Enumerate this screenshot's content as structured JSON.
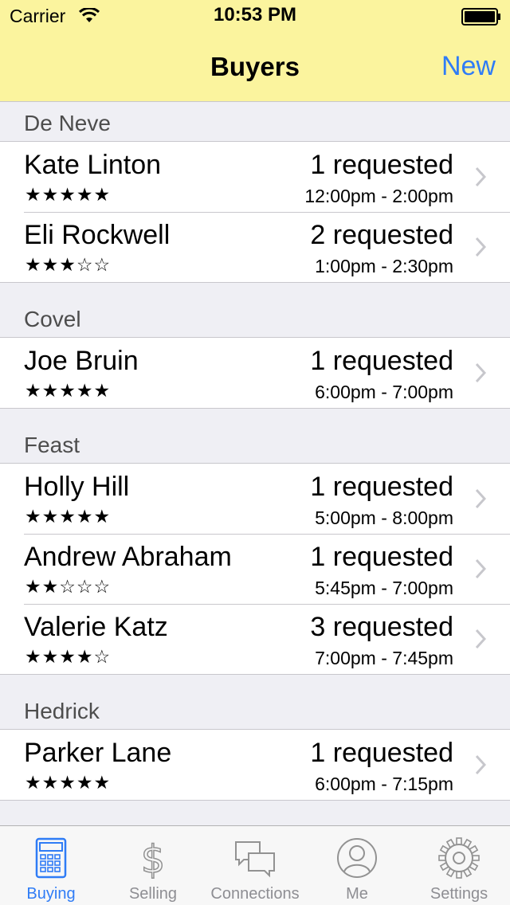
{
  "status_bar": {
    "carrier": "Carrier",
    "time": "10:53 PM"
  },
  "nav": {
    "title": "Buyers",
    "new_label": "New"
  },
  "accent_color": "#2f7cf6",
  "header_color": "#fbf49e",
  "sections": [
    {
      "title": "De Neve",
      "rows": [
        {
          "name": "Kate Linton",
          "stars": "★★★★★",
          "rating": 5,
          "requested": "1 requested",
          "time": "12:00pm - 2:00pm"
        },
        {
          "name": "Eli Rockwell",
          "stars": "★★★☆☆",
          "rating": 3,
          "requested": "2 requested",
          "time": "1:00pm - 2:30pm"
        }
      ]
    },
    {
      "title": "Covel",
      "rows": [
        {
          "name": "Joe Bruin",
          "stars": "★★★★★",
          "rating": 5,
          "requested": "1 requested",
          "time": "6:00pm - 7:00pm"
        }
      ]
    },
    {
      "title": "Feast",
      "rows": [
        {
          "name": "Holly Hill",
          "stars": "★★★★★",
          "rating": 5,
          "requested": "1 requested",
          "time": "5:00pm - 8:00pm"
        },
        {
          "name": "Andrew Abraham",
          "stars": "★★☆☆☆",
          "rating": 2,
          "requested": "1 requested",
          "time": "5:45pm - 7:00pm"
        },
        {
          "name": "Valerie Katz",
          "stars": "★★★★☆",
          "rating": 4,
          "requested": "3 requested",
          "time": "7:00pm - 7:45pm"
        }
      ]
    },
    {
      "title": "Hedrick",
      "rows": [
        {
          "name": "Parker Lane",
          "stars": "★★★★★",
          "rating": 5,
          "requested": "1 requested",
          "time": "6:00pm - 7:15pm"
        }
      ]
    }
  ],
  "tabs": [
    {
      "label": "Buying",
      "icon": "calculator-icon",
      "active": true
    },
    {
      "label": "Selling",
      "icon": "dollar-icon",
      "active": false
    },
    {
      "label": "Connections",
      "icon": "chat-bubbles-icon",
      "active": false
    },
    {
      "label": "Me",
      "icon": "person-icon",
      "active": false
    },
    {
      "label": "Settings",
      "icon": "gear-icon",
      "active": false
    }
  ]
}
